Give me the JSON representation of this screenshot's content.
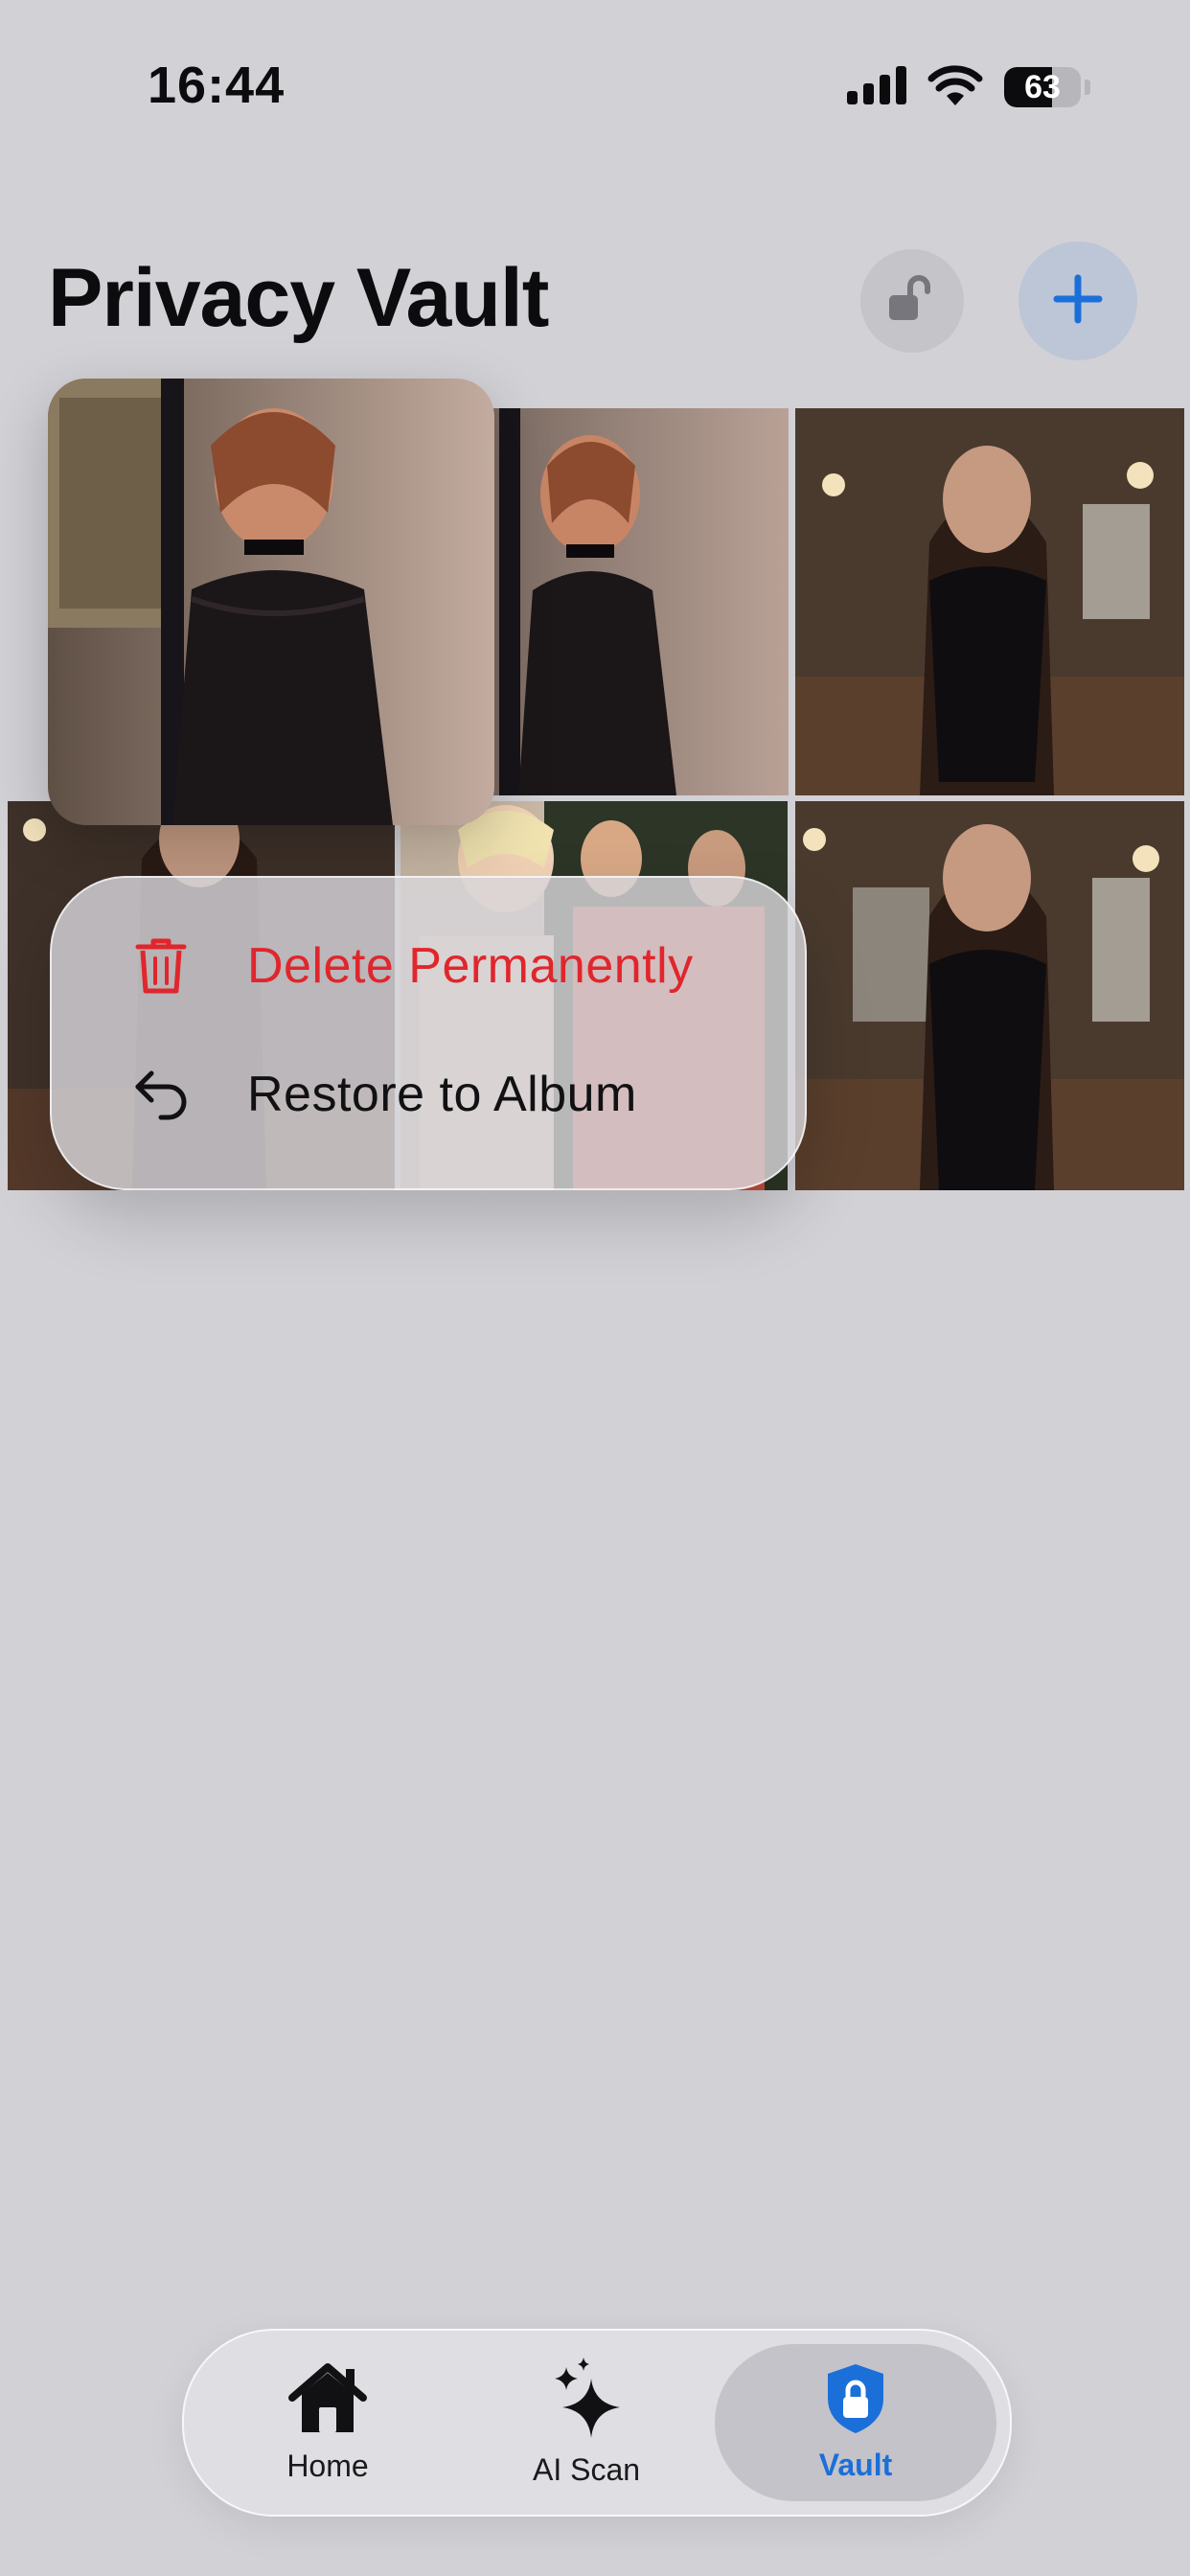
{
  "status_bar": {
    "time": "16:44",
    "battery_percent": "63",
    "battery_level": 0.63,
    "icons": [
      "cellular-signal-icon",
      "wifi-icon",
      "battery-icon"
    ]
  },
  "header": {
    "title": "Privacy Vault",
    "lock_icon": "unlocked-padlock-icon",
    "add_icon": "plus-icon"
  },
  "colors": {
    "accent": "#1b6fd9",
    "destructive": "#e0262c",
    "background": "#d2d1d6",
    "text": "#0c0c0e"
  },
  "photos": [
    {
      "id": "photo-1",
      "subject": "redhead-lace-dress",
      "selected": true
    },
    {
      "id": "photo-2",
      "subject": "redhead-lace-dress"
    },
    {
      "id": "photo-3",
      "subject": "brunette-black-dress-restaurant"
    },
    {
      "id": "photo-4",
      "subject": "brunette-restaurant"
    },
    {
      "id": "photo-5",
      "subject": "vintage-group-photo"
    },
    {
      "id": "photo-6",
      "subject": "brunette-black-dress-restaurant"
    }
  ],
  "context_menu": {
    "items": [
      {
        "label": "Delete Permanently",
        "icon": "trash-icon",
        "destructive": true
      },
      {
        "label": "Restore to Album",
        "icon": "undo-arrow-icon",
        "destructive": false
      }
    ]
  },
  "tab_bar": {
    "tabs": [
      {
        "label": "Home",
        "icon": "house-icon",
        "active": false
      },
      {
        "label": "AI Scan",
        "icon": "sparkles-icon",
        "active": false
      },
      {
        "label": "Vault",
        "icon": "lock-shield-icon",
        "active": true
      }
    ]
  }
}
